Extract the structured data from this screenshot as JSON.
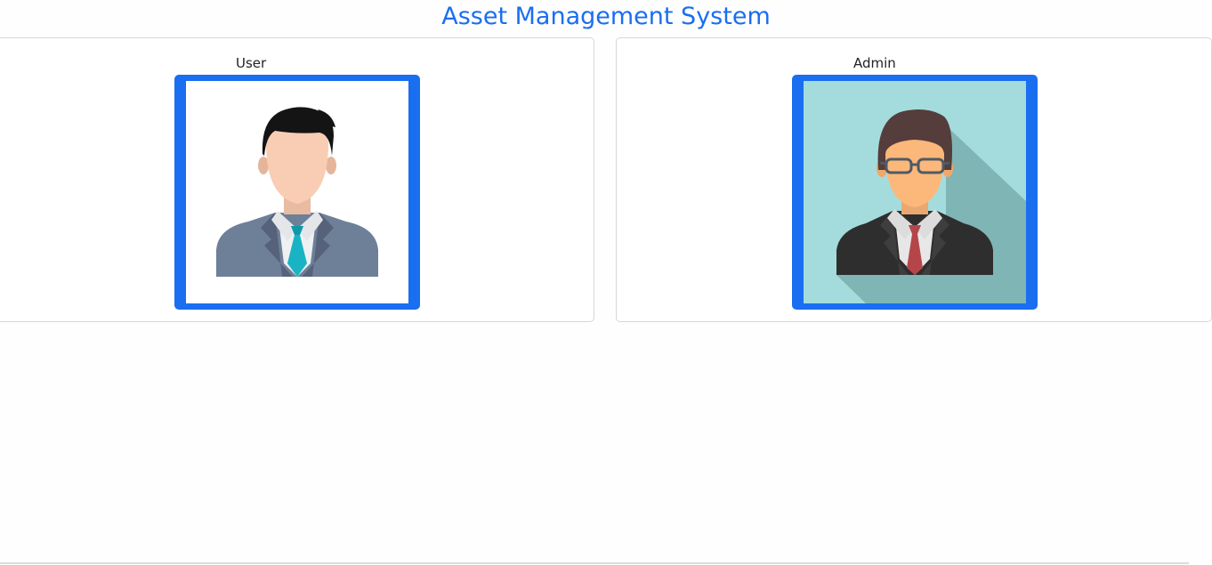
{
  "header": {
    "title": "Asset Management System"
  },
  "cards": [
    {
      "label": "User",
      "avatar_icon": "user-avatar-icon"
    },
    {
      "label": "Admin",
      "avatar_icon": "admin-avatar-icon"
    }
  ],
  "colors": {
    "accent": "#1a6ef0",
    "user_bg": "#ffffff",
    "admin_bg": "#a4dcdd"
  }
}
